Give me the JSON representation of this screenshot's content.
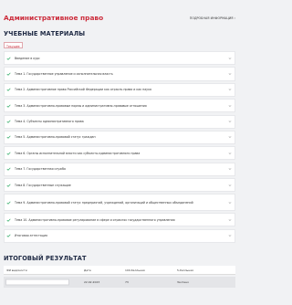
{
  "header": {
    "title": "Административное право",
    "details_link": "ПОДРОБНАЯ ИНФОРМАЦИЯ",
    "details_arrow": "›"
  },
  "materials": {
    "title": "УЧЕБНЫЕ МАТЕРИАЛЫ",
    "current_tag": "Текущее",
    "items": [
      {
        "label": "Введение в курс"
      },
      {
        "label": "Тема 1. Государственное управление и исполнительная власть"
      },
      {
        "label": "Тема 2. Административное право Российской Федерации как отрасль права и как наука"
      },
      {
        "label": "Тема 3. Административно-правовые нормы и административно-правовые отношения"
      },
      {
        "label": "Тема 4. Субъекты административного права"
      },
      {
        "label": "Тема 5. Административно-правовой статус граждан"
      },
      {
        "label": "Тема 6. Органы исполнительной власти как субъекты административного права"
      },
      {
        "label": "Тема 7. Государственная служба"
      },
      {
        "label": "Тема 8. Государственные служащие"
      },
      {
        "label": "Тема 9. Административно-правовой статус предприятий, учреждений, организаций и общественных объединений"
      },
      {
        "label": "Тема 10. Административно-правовое регулирование в сфере и отраслях государственного управления"
      },
      {
        "label": "Итоговая аттестация"
      }
    ]
  },
  "result": {
    "title": "ИТОГОВЫЙ РЕЗУЛЬТАТ",
    "columns": [
      "ФИ ведомости",
      "Дата",
      "100-балльная",
      "5-балльная"
    ],
    "rows": [
      {
        "name": "",
        "date": "22.02.2023",
        "score100": "73",
        "score5": "Зачтено"
      }
    ]
  },
  "colors": {
    "accent": "#cc2b3a",
    "heading": "#1f2a44",
    "check": "#1fa45a"
  },
  "icons": {
    "check": "check-icon",
    "chevron": "chevron-down-icon"
  }
}
